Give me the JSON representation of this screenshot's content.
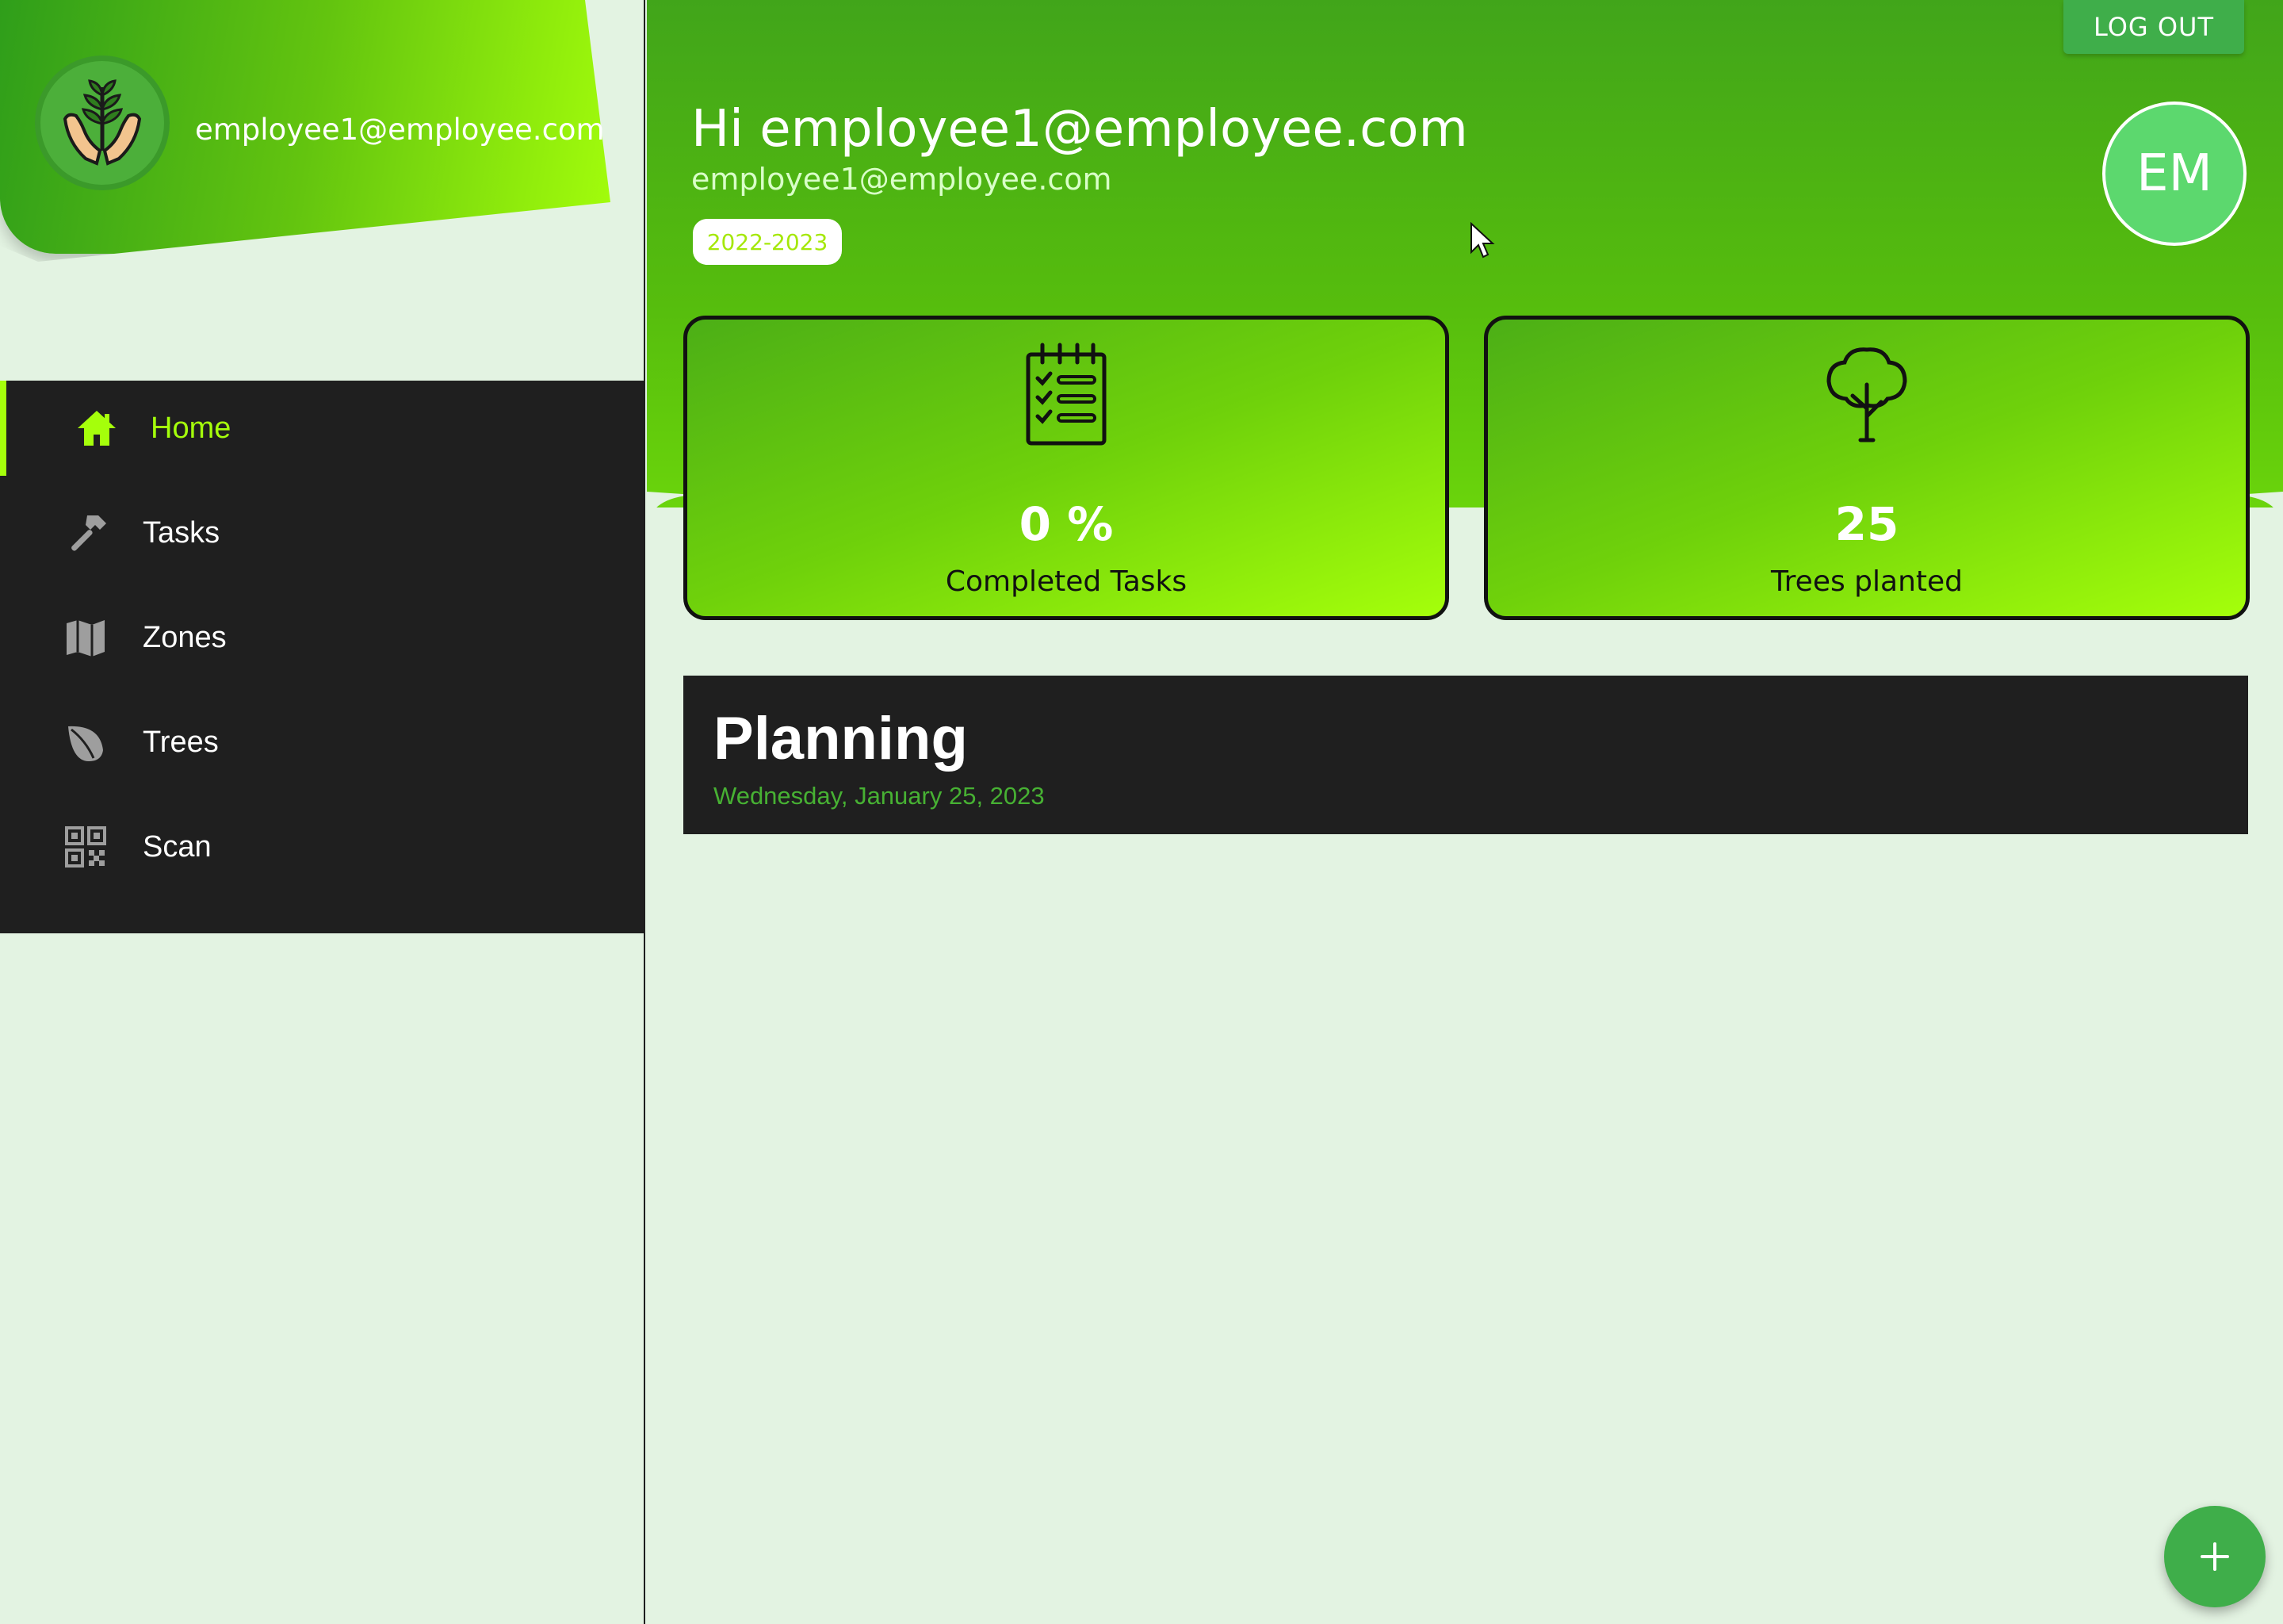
{
  "sidebar": {
    "profile_email": "employee1@employee.com",
    "logo_icon": "hands-plant-icon",
    "nav": [
      {
        "label": "Home",
        "icon": "home-icon",
        "active": true
      },
      {
        "label": "Tasks",
        "icon": "hammer-icon",
        "active": false
      },
      {
        "label": "Zones",
        "icon": "map-icon",
        "active": false
      },
      {
        "label": "Trees",
        "icon": "leaf-icon",
        "active": false
      },
      {
        "label": "Scan",
        "icon": "qr-code-icon",
        "active": false
      }
    ]
  },
  "header": {
    "logout_label": "LOG OUT",
    "greeting": "Hi employee1@employee.com",
    "email": "employee1@employee.com",
    "year": "2022-2023",
    "avatar_initials": "EM"
  },
  "stats": [
    {
      "value": "0 %",
      "label": "Completed Tasks",
      "icon": "clipboard-checklist-icon"
    },
    {
      "value": "25",
      "label": "Trees planted",
      "icon": "tree-icon"
    }
  ],
  "planning": {
    "title": "Planning",
    "date": "Wednesday, January 25, 2023"
  },
  "fab": {
    "icon": "plus-icon"
  },
  "colors": {
    "accent": "#a5ff0b",
    "primary_green": "#3fae4a",
    "dark": "#1f1f1f",
    "background": "#e3f3e2"
  }
}
